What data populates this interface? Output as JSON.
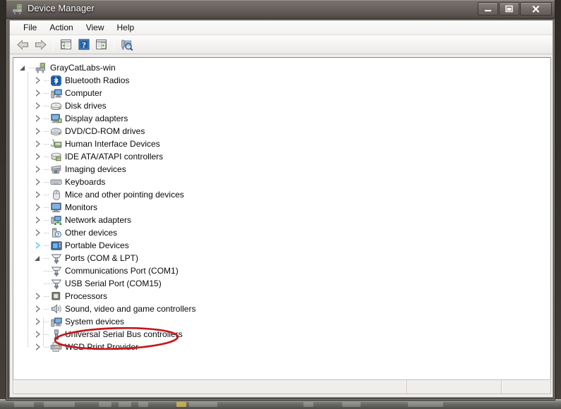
{
  "window": {
    "title": "Device Manager",
    "title_icon": "device-manager-icon",
    "minimize_label": "Minimize",
    "maximize_label": "Maximize",
    "close_label": "Close"
  },
  "menubar": {
    "items": [
      {
        "label": "File",
        "name": "menu-file"
      },
      {
        "label": "Action",
        "name": "menu-action"
      },
      {
        "label": "View",
        "name": "menu-view"
      },
      {
        "label": "Help",
        "name": "menu-help"
      }
    ]
  },
  "toolbar": {
    "buttons": [
      {
        "icon": "back-arrow-icon",
        "tooltip": "Back"
      },
      {
        "icon": "forward-arrow-icon",
        "tooltip": "Forward"
      },
      {
        "icon": "show-console-tree-icon",
        "tooltip": "Show/Hide Console Tree"
      },
      {
        "icon": "help-question-icon",
        "tooltip": "Help"
      },
      {
        "icon": "properties-icon",
        "tooltip": "Properties"
      },
      {
        "icon": "scan-for-hardware-changes-icon",
        "tooltip": "Scan for hardware changes"
      }
    ]
  },
  "tree": {
    "root": {
      "label": "GrayCatLabs-win",
      "icon": "computer-root-icon",
      "expanded": true
    },
    "items": [
      {
        "label": "Bluetooth Radios",
        "icon": "bluetooth-icon",
        "state": "collapsed",
        "level": 1
      },
      {
        "label": "Computer",
        "icon": "computer-icon",
        "state": "collapsed",
        "level": 1
      },
      {
        "label": "Disk drives",
        "icon": "disk-drive-icon",
        "state": "collapsed",
        "level": 1
      },
      {
        "label": "Display adapters",
        "icon": "display-adapter-icon",
        "state": "collapsed",
        "level": 1
      },
      {
        "label": "DVD/CD-ROM drives",
        "icon": "dvd-drive-icon",
        "state": "collapsed",
        "level": 1
      },
      {
        "label": "Human Interface Devices",
        "icon": "hid-icon",
        "state": "collapsed",
        "level": 1
      },
      {
        "label": "IDE ATA/ATAPI controllers",
        "icon": "ide-controller-icon",
        "state": "collapsed",
        "level": 1
      },
      {
        "label": "Imaging devices",
        "icon": "imaging-device-icon",
        "state": "collapsed",
        "level": 1
      },
      {
        "label": "Keyboards",
        "icon": "keyboard-icon",
        "state": "collapsed",
        "level": 1
      },
      {
        "label": "Mice and other pointing devices",
        "icon": "mouse-icon",
        "state": "collapsed",
        "level": 1
      },
      {
        "label": "Monitors",
        "icon": "monitor-icon",
        "state": "collapsed",
        "level": 1
      },
      {
        "label": "Network adapters",
        "icon": "network-adapter-icon",
        "state": "collapsed",
        "level": 1
      },
      {
        "label": "Other devices",
        "icon": "other-device-icon",
        "state": "collapsed",
        "level": 1
      },
      {
        "label": "Portable Devices",
        "icon": "portable-device-icon",
        "state": "collapsed-hover",
        "level": 1
      },
      {
        "label": "Ports (COM & LPT)",
        "icon": "port-icon",
        "state": "expanded",
        "level": 1
      },
      {
        "label": "Communications Port (COM1)",
        "icon": "port-icon",
        "state": "leaf",
        "level": 2
      },
      {
        "label": "USB Serial Port (COM15)",
        "icon": "port-icon",
        "state": "leaf",
        "level": 2,
        "annotated": true
      },
      {
        "label": "Processors",
        "icon": "processor-icon",
        "state": "collapsed",
        "level": 1
      },
      {
        "label": "Sound, video and game controllers",
        "icon": "sound-icon",
        "state": "collapsed",
        "level": 1
      },
      {
        "label": "System devices",
        "icon": "system-device-icon",
        "state": "collapsed",
        "level": 1
      },
      {
        "label": "Universal Serial Bus controllers",
        "icon": "usb-controller-icon",
        "state": "collapsed",
        "level": 1
      },
      {
        "label": "WSD Print Provider",
        "icon": "printer-icon",
        "state": "collapsed",
        "level": 1
      }
    ]
  },
  "annotation": {
    "type": "ellipse-highlight",
    "target": "USB Serial Port (COM15)",
    "color": "#c3181e"
  },
  "statusbar": {
    "panes": [
      "",
      "",
      ""
    ]
  },
  "colors": {
    "titlebar_dark": "#6a635e",
    "client_bg": "#f0eeec",
    "tree_bg": "#ffffff",
    "annotation_red": "#c3181e",
    "accent_blue": "#1c5fa8"
  }
}
